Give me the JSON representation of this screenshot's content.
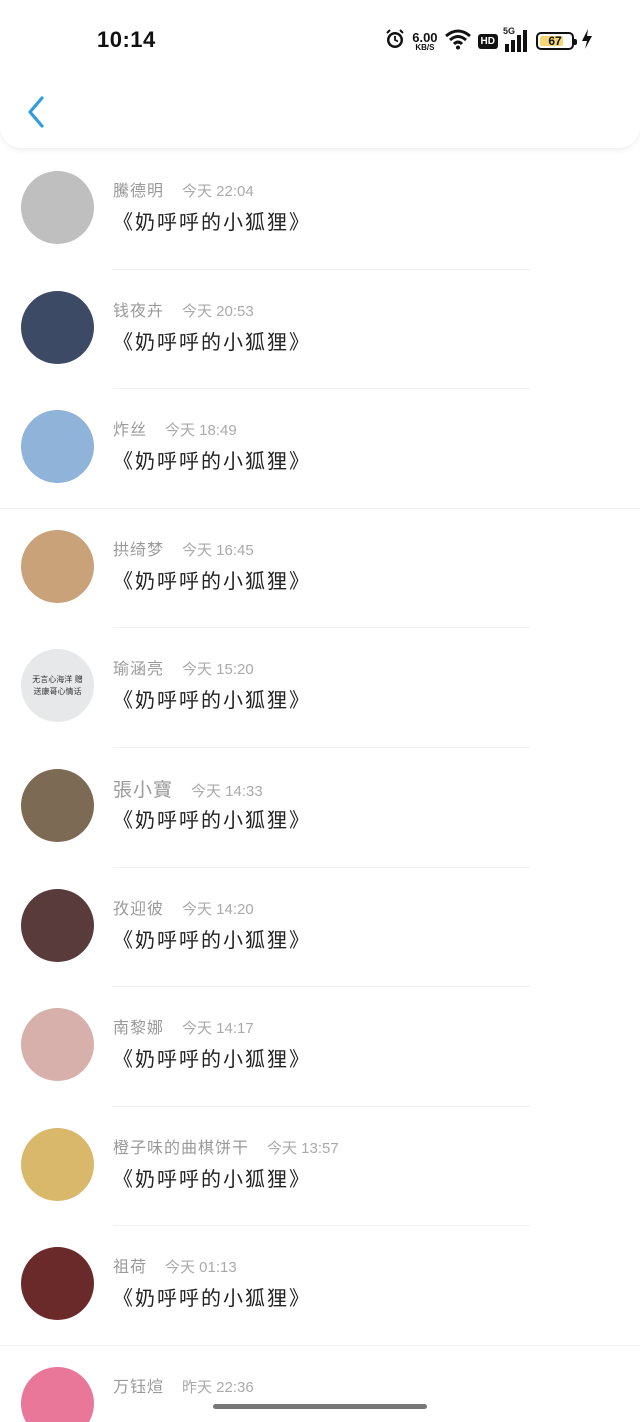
{
  "status_bar": {
    "time": "10:14",
    "net_speed": "6.00",
    "net_speed_unit": "KB/S",
    "hd": "HD",
    "network": "5G",
    "battery": "67"
  },
  "comments": [
    {
      "name": "騰德明",
      "time": "今天 22:04",
      "text": "《奶呼呼的小狐狸》",
      "avatar_color": "#bfbfbf"
    },
    {
      "name": "钱夜卉",
      "time": "今天 20:53",
      "text": "《奶呼呼的小狐狸》",
      "avatar_color": "#3d4a66"
    },
    {
      "name": "炸丝",
      "time": "今天 18:49",
      "text": "《奶呼呼的小狐狸》",
      "avatar_color": "#8fb3d9"
    },
    {
      "name": "拱绮梦",
      "time": "今天 16:45",
      "text": "《奶呼呼的小狐狸》",
      "avatar_color": "#c9a27a"
    },
    {
      "name": "瑜涵亮",
      "time": "今天 15:20",
      "text": "《奶呼呼的小狐狸》",
      "avatar_color": "#e6e8ea",
      "avatar_caption": "无言心海洋 赠送康哥心情话"
    },
    {
      "name": "張小寶",
      "time": "今天 14:33",
      "text": "《奶呼呼的小狐狸》",
      "avatar_color": "#7d6a55"
    },
    {
      "name": "孜迎彼",
      "time": "今天 14:20",
      "text": "《奶呼呼的小狐狸》",
      "avatar_color": "#5a3b3b"
    },
    {
      "name": "南黎娜",
      "time": "今天 14:17",
      "text": "《奶呼呼的小狐狸》",
      "avatar_color": "#d8b0ab"
    },
    {
      "name": "橙子味的曲棋饼干",
      "time": "今天 13:57",
      "text": "《奶呼呼的小狐狸》",
      "avatar_color": "#d9b86b"
    },
    {
      "name": "祖荷",
      "time": "今天 01:13",
      "text": "《奶呼呼的小狐狸》",
      "avatar_color": "#6b2a2a"
    },
    {
      "name": "万钰煊",
      "time": "昨天 22:36",
      "text": "",
      "avatar_color": "#e8779a"
    }
  ]
}
